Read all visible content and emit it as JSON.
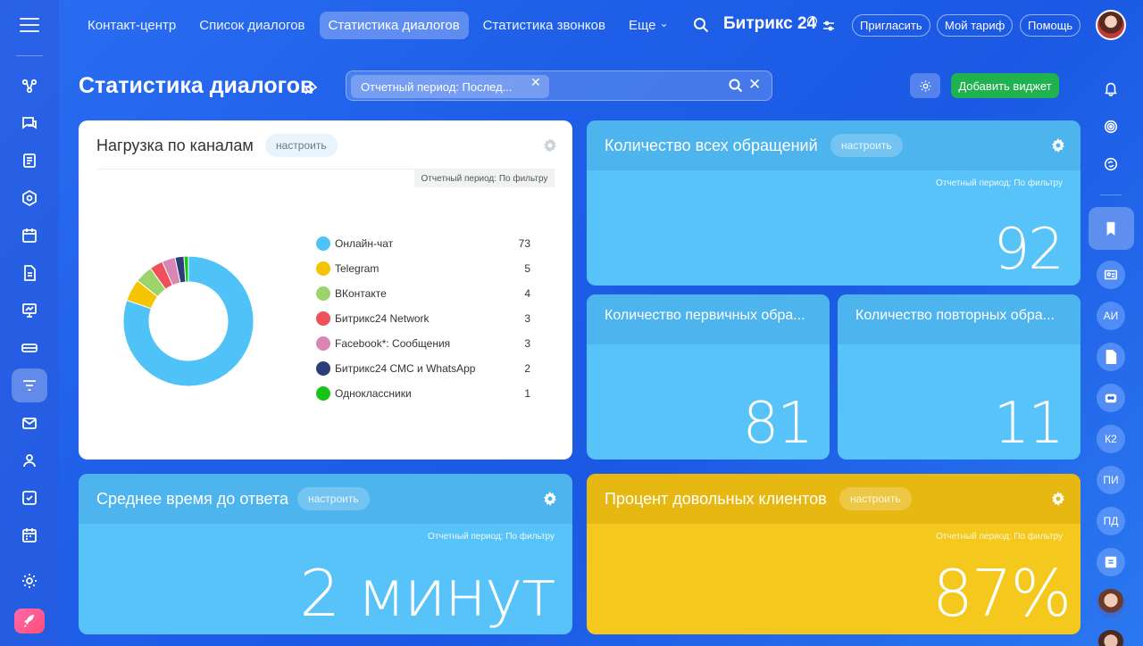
{
  "nav": {
    "items": [
      "Контакт-центр",
      "Список диалогов",
      "Статистика диалогов",
      "Статистика звонков",
      "Еще"
    ],
    "active_index": 2
  },
  "brand": {
    "name": "Битрикс 24"
  },
  "header_buttons": {
    "invite": "Пригласить",
    "tariff": "Мой тариф",
    "help": "Помощь"
  },
  "page": {
    "title": "Статистика диалогов"
  },
  "filter": {
    "chip": "Отчетный период: Послед..."
  },
  "actions": {
    "add_widget": "Добавить виджет"
  },
  "colors": {
    "accent_green": "#1fb24f",
    "widget_blue": "#57c3f8",
    "widget_yellow": "#f4c81c",
    "background": "#1f5fe8"
  },
  "right_bar": {
    "initials": [
      "АИ",
      "К2",
      "ПИ",
      "ПД"
    ]
  },
  "widgets": {
    "channels": {
      "title": "Нагрузка по каналам",
      "setup": "настроить",
      "period": "Отчетный период: По фильтру"
    },
    "total": {
      "title": "Количество всех обращений",
      "setup": "настроить",
      "period": "Отчетный период: По фильтру",
      "value": "92"
    },
    "first": {
      "title": "Количество первичных обра...",
      "value": "81"
    },
    "repeat": {
      "title": "Количество повторных обра...",
      "value": "11"
    },
    "response": {
      "title": "Среднее время до ответа",
      "setup": "настроить",
      "period": "Отчетный период: По фильтру",
      "value": "2 минут"
    },
    "satisfied": {
      "title": "Процент довольных клиентов",
      "setup": "настроить",
      "period": "Отчетный период: По фильтру",
      "value": "87%"
    }
  },
  "chart_data": {
    "type": "pie",
    "donut": true,
    "legend_position": "right",
    "categories": [
      "Онлайн-чат",
      "Telegram",
      "ВКонтакте",
      "Битрикс24 Network",
      "Facebook*: Сообщения",
      "Битрикс24 СМС и WhatsApp",
      "Одноклассники"
    ],
    "values": [
      73,
      5,
      4,
      3,
      3,
      2,
      1
    ],
    "colors": [
      "#4fc3f7",
      "#f5c400",
      "#9ad46a",
      "#f0505a",
      "#d886b4",
      "#2c3e7a",
      "#19c419"
    ]
  }
}
